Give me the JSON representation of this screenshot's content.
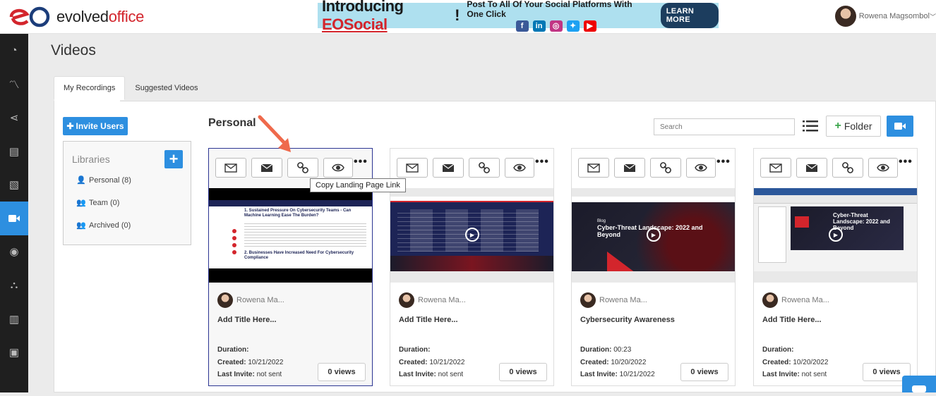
{
  "logo": {
    "text_prefix": "evolved",
    "text_suffix": "office"
  },
  "banner": {
    "intro": "Introducing ",
    "brand": "EOSocial",
    "sep": "!",
    "tagline": "Post To All Of Your Social Platforms With One Click",
    "socials": [
      {
        "icon": "facebook-icon",
        "glyph": "f",
        "color": "#3b5998"
      },
      {
        "icon": "linkedin-icon",
        "glyph": "in",
        "color": "#0077b5"
      },
      {
        "icon": "instagram-icon",
        "glyph": "◎",
        "color": "#c13584"
      },
      {
        "icon": "twitter-icon",
        "glyph": "✦",
        "color": "#1da1f2"
      },
      {
        "icon": "youtube-icon",
        "glyph": "▶",
        "color": "#e00"
      }
    ],
    "button": "LEARN MORE"
  },
  "user": {
    "name": "Rowena Magsombol",
    "caret": "﹀"
  },
  "sidebar": [
    {
      "icon": "dashboard-icon",
      "glyph": "◔"
    },
    {
      "icon": "analytics-icon",
      "glyph": "〽"
    },
    {
      "icon": "share-icon",
      "glyph": "⋖"
    },
    {
      "icon": "newsletter-icon",
      "glyph": "▤"
    },
    {
      "icon": "image-icon",
      "glyph": "▧"
    },
    {
      "icon": "video-icon",
      "glyph": "■",
      "active": true
    },
    {
      "icon": "contacts-icon",
      "glyph": "◉"
    },
    {
      "icon": "org-chart-icon",
      "glyph": "⛬"
    },
    {
      "icon": "reports-icon",
      "glyph": "▥"
    },
    {
      "icon": "briefcase-icon",
      "glyph": "▣"
    }
  ],
  "page": {
    "title": "Videos"
  },
  "tabs": [
    "My Recordings",
    "Suggested Videos"
  ],
  "invite_button": "Invite Users",
  "libraries": {
    "title": "Libraries",
    "add": "+",
    "items": [
      {
        "label": "Personal (8)",
        "icon": "person-icon",
        "glyph": "●"
      },
      {
        "label": "Team (0)",
        "icon": "team-icon",
        "glyph": "●●"
      },
      {
        "label": "Archived (0)",
        "icon": "archived-icon",
        "glyph": "●●"
      }
    ]
  },
  "section_title": "Personal",
  "search": {
    "placeholder": "Search"
  },
  "folder_button": {
    "plus": "+",
    "label": "Folder"
  },
  "tooltip": "Copy Landing Page Link",
  "cards": [
    {
      "owner": "Rowena Ma...",
      "title": "Add Title Here...",
      "duration_label": "Duration:",
      "duration": "",
      "created_label": "Created:",
      "created": "10/21/2022",
      "invite_label": "Last Invite:",
      "invite": "not sent",
      "views": "0  views",
      "more": "•••"
    },
    {
      "owner": "Rowena Ma...",
      "title": "Add Title Here...",
      "duration_label": "Duration:",
      "duration": "",
      "created_label": "Created:",
      "created": "10/21/2022",
      "invite_label": "Last Invite:",
      "invite": "not sent",
      "views": "0  views",
      "more": "•••"
    },
    {
      "owner": "Rowena Ma...",
      "title": "Cybersecurity Awareness",
      "duration_label": "Duration:",
      "duration": "00:23",
      "created_label": "Created:",
      "created": "10/20/2022",
      "invite_label": "Last Invite:",
      "invite": "10/21/2022",
      "views": "0  views",
      "more": "•••"
    },
    {
      "owner": "Rowena Ma...",
      "title": "Add Title Here...",
      "duration_label": "Duration:",
      "duration": "",
      "created_label": "Created:",
      "created": "10/20/2022",
      "invite_label": "Last Invite:",
      "invite": "not sent",
      "views": "0  views",
      "more": "•••"
    }
  ],
  "thumb_text": {
    "card0": {
      "h1": "1. Sustained Pressure On Cybersecurity Teams - Can Machine Learning Ease The Burden?",
      "h2": "2. Businesses Have Increased Need For Cybersecurity Compliance"
    },
    "card2": {
      "tag": "Blog",
      "headline": "Cyber-Threat Landscape: 2022 and Beyond"
    },
    "card3": {
      "headline": "Cyber-Threat Landscape: 2022 and Beyond"
    }
  }
}
